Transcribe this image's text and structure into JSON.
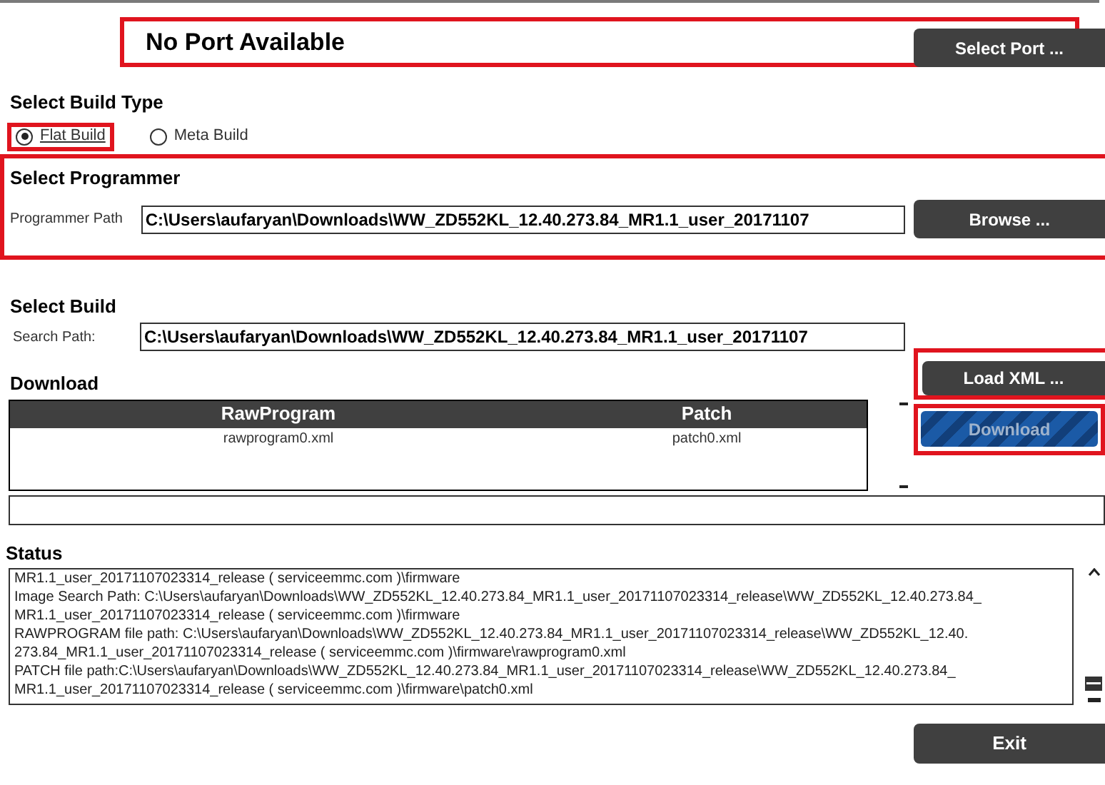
{
  "port": {
    "status": "No Port Available",
    "button": "Select Port ..."
  },
  "build_type": {
    "title": "Select Build Type",
    "options": [
      {
        "label": "Flat Build",
        "selected": true
      },
      {
        "label": "Meta Build",
        "selected": false
      }
    ]
  },
  "programmer": {
    "title": "Select Programmer",
    "label": "Programmer Path",
    "value": "C:\\Users\\aufaryan\\Downloads\\WW_ZD552KL_12.40.273.84_MR1.1_user_20171107",
    "button": "Browse ..."
  },
  "build": {
    "title": "Select Build",
    "label": "Search Path:",
    "value": "C:\\Users\\aufaryan\\Downloads\\WW_ZD552KL_12.40.273.84_MR1.1_user_20171107"
  },
  "download": {
    "title": "Download",
    "columns": [
      "RawProgram",
      "Patch"
    ],
    "rows": [
      [
        "rawprogram0.xml",
        "patch0.xml"
      ]
    ],
    "load_button": "Load XML ...",
    "download_button": "Download",
    "progress": {
      "level": 0
    }
  },
  "status": {
    "title": "Status",
    "lines": [
      "MR1.1_user_20171107023314_release ( serviceemmc.com )\\firmware",
      "Image Search Path: C:\\Users\\aufaryan\\Downloads\\WW_ZD552KL_12.40.273.84_MR1.1_user_20171107023314_release\\WW_ZD552KL_12.40.273.84_",
      "MR1.1_user_20171107023314_release ( serviceemmc.com )\\firmware",
      "RAWPROGRAM file path: C:\\Users\\aufaryan\\Downloads\\WW_ZD552KL_12.40.273.84_MR1.1_user_20171107023314_release\\WW_ZD552KL_12.40.",
      "273.84_MR1.1_user_20171107023314_release ( serviceemmc.com )\\firmware\\rawprogram0.xml",
      "PATCH file path:C:\\Users\\aufaryan\\Downloads\\WW_ZD552KL_12.40.273.84_MR1.1_user_20171107023314_release\\WW_ZD552KL_12.40.273.84_",
      "MR1.1_user_20171107023314_release ( serviceemmc.com )\\firmware\\patch0.xml"
    ]
  },
  "exit_button": "Exit"
}
